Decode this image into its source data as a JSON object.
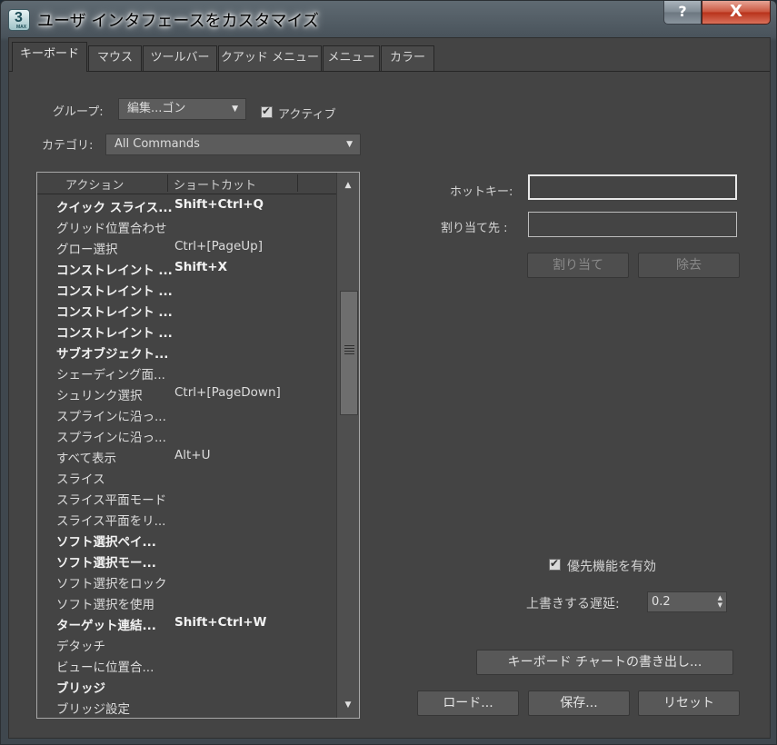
{
  "window": {
    "title": "ユーザ インタフェースをカスタマイズ",
    "icon_text": "3",
    "icon_subtext": "MAX",
    "help_label": "?",
    "close_label": "X"
  },
  "tabs": [
    {
      "label": "キーボード",
      "active": true
    },
    {
      "label": "マウス"
    },
    {
      "label": "ツールバー"
    },
    {
      "label": "クアッド メニュー"
    },
    {
      "label": "メニュー"
    },
    {
      "label": "カラー"
    }
  ],
  "group": {
    "label": "グループ:",
    "value": "編集...ゴン"
  },
  "active_checkbox": {
    "label": "アクティブ",
    "checked": true
  },
  "category": {
    "label": "カテゴリ:",
    "value": "All Commands"
  },
  "list": {
    "headers": {
      "action": "アクション",
      "shortcut": "ショートカット"
    },
    "rows": [
      {
        "action": "クイック スライス...",
        "shortcut": "Shift+Ctrl+Q",
        "bold": true
      },
      {
        "action": "グリッド位置合わせ",
        "shortcut": ""
      },
      {
        "action": "グロー選択",
        "shortcut": "Ctrl+[PageUp]"
      },
      {
        "action": "コンストレイント ...",
        "shortcut": "Shift+X",
        "bold": true
      },
      {
        "action": "コンストレイント ...",
        "shortcut": "",
        "bold": true
      },
      {
        "action": "コンストレイント ...",
        "shortcut": "",
        "bold": true
      },
      {
        "action": "コンストレイント ...",
        "shortcut": "",
        "bold": true
      },
      {
        "action": "サブオブジェクト...",
        "shortcut": "",
        "bold": true
      },
      {
        "action": "シェーディング面...",
        "shortcut": ""
      },
      {
        "action": "シュリンク選択",
        "shortcut": "Ctrl+[PageDown]"
      },
      {
        "action": "スプラインに沿っ...",
        "shortcut": ""
      },
      {
        "action": "スプラインに沿っ...",
        "shortcut": ""
      },
      {
        "action": "すべて表示",
        "shortcut": "Alt+U"
      },
      {
        "action": "スライス",
        "shortcut": ""
      },
      {
        "action": "スライス平面モード",
        "shortcut": ""
      },
      {
        "action": "スライス平面をリ...",
        "shortcut": ""
      },
      {
        "action": "ソフト選択ペイ...",
        "shortcut": "",
        "bold": true
      },
      {
        "action": "ソフト選択モー...",
        "shortcut": "",
        "bold": true
      },
      {
        "action": "ソフト選択をロック",
        "shortcut": ""
      },
      {
        "action": "ソフト選択を使用",
        "shortcut": ""
      },
      {
        "action": "ターゲット連結...",
        "shortcut": "Shift+Ctrl+W",
        "bold": true
      },
      {
        "action": "デタッチ",
        "shortcut": ""
      },
      {
        "action": "ビューに位置合...",
        "shortcut": ""
      },
      {
        "action": "ブリッジ",
        "shortcut": "",
        "bold": true
      },
      {
        "action": "ブリッジ設定",
        "shortcut": ""
      }
    ]
  },
  "hotkey": {
    "label": "ホットキー:",
    "value": ""
  },
  "assigned_to": {
    "label": "割り当て先 :",
    "value": ""
  },
  "assign_button": "割り当て",
  "remove_button": "除去",
  "priority_checkbox": {
    "label": "優先機能を有効",
    "checked": true
  },
  "override_delay": {
    "label": "上書きする遅延:",
    "value": "0.2"
  },
  "export_button": "キーボード チャートの書き出し...",
  "load_button": "ロード...",
  "save_button": "保存...",
  "reset_button": "リセット"
}
